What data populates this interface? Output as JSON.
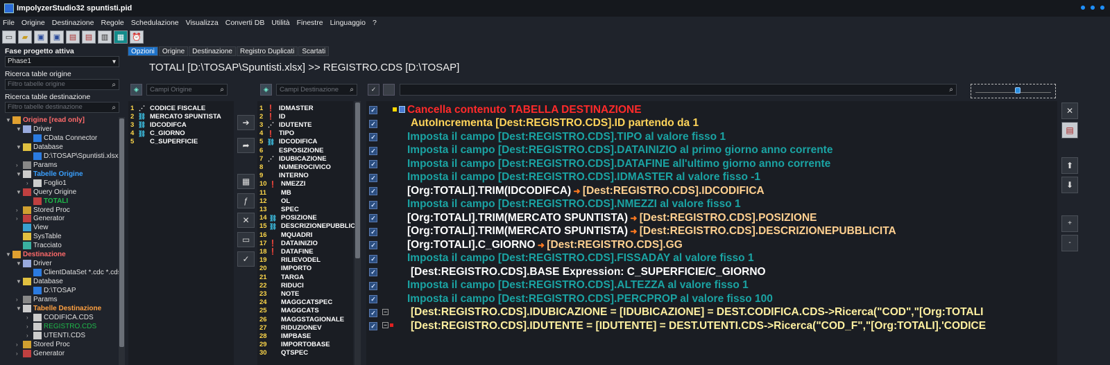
{
  "app": {
    "title": "ImpolyzerStudio32 spuntisti.pid"
  },
  "menu": [
    "File",
    "Origine",
    "Destinazione",
    "Regole",
    "Schedulazione",
    "Visualizza",
    "Converti DB",
    "Utilità",
    "Finestre",
    "Linguaggio",
    "?"
  ],
  "toolbar": {
    "buttons": [
      "new-file-icon",
      "open-folder-icon",
      "save-icon",
      "save-as-icon",
      "print-icon",
      "print-preview-icon",
      "document-icon",
      "execute-icon",
      "schedule-icon"
    ]
  },
  "left": {
    "phase_label": "Fase progetto attiva",
    "phase_value": "Phase1",
    "search_origin_label": "Ricerca table origine",
    "search_origin_placeholder": "Filtro tabelle origine",
    "search_dest_label": "Ricerca table destinazione",
    "search_dest_placeholder": "Filtro tabelle destinazione",
    "tree": [
      {
        "label": "Origine [read only]",
        "level": 0,
        "color": "#ff6a6a",
        "bold": true,
        "exp": "▼",
        "icon": "#e0a030"
      },
      {
        "label": "Driver",
        "level": 1,
        "color": "#e0e0e0",
        "exp": "▼",
        "icon": "#9ad"
      },
      {
        "label": "CData Connector",
        "level": 2,
        "color": "#e0e0e0",
        "exp": "",
        "icon": "#2b7be0"
      },
      {
        "label": "Database",
        "level": 1,
        "color": "#e0e0e0",
        "exp": "▼",
        "icon": "#e0c040"
      },
      {
        "label": "D:\\TOSAP\\Spuntisti.xlsx",
        "level": 2,
        "color": "#e0e0e0",
        "exp": "",
        "icon": "#2b7be0"
      },
      {
        "label": "Params",
        "level": 1,
        "color": "#e0e0e0",
        "exp": "›",
        "icon": "#888"
      },
      {
        "label": "Tabelle Origine",
        "level": 1,
        "color": "#3aa0ff",
        "bold": true,
        "exp": "▼",
        "icon": "#ccc"
      },
      {
        "label": "Foglio1",
        "level": 2,
        "color": "#e0e0e0",
        "exp": "›",
        "icon": "#ccc"
      },
      {
        "label": "Query Origine",
        "level": 1,
        "color": "#e0e0e0",
        "exp": "▼",
        "icon": "#c04040"
      },
      {
        "label": "TOTALI",
        "level": 2,
        "color": "#1fb84a",
        "bold": true,
        "exp": "",
        "icon": "#c04040"
      },
      {
        "label": "Stored Proc",
        "level": 1,
        "color": "#e0e0e0",
        "exp": "›",
        "icon": "#d0a030"
      },
      {
        "label": "Generator",
        "level": 1,
        "color": "#e0e0e0",
        "exp": "›",
        "icon": "#c04040"
      },
      {
        "label": "View",
        "level": 1,
        "color": "#e0e0e0",
        "exp": "",
        "icon": "#3aa0d0"
      },
      {
        "label": "SysTable",
        "level": 1,
        "color": "#e0e0e0",
        "exp": "",
        "icon": "#e0c040"
      },
      {
        "label": "Tracciato",
        "level": 1,
        "color": "#e0e0e0",
        "exp": "",
        "icon": "#3ab0a0"
      },
      {
        "label": "Destinazione",
        "level": 0,
        "color": "#ff6a6a",
        "bold": true,
        "exp": "▼",
        "icon": "#e0a030"
      },
      {
        "label": "Driver",
        "level": 1,
        "color": "#e0e0e0",
        "exp": "▼",
        "icon": "#9ad"
      },
      {
        "label": "ClientDataSet *.cdc *.cds",
        "level": 2,
        "color": "#e0e0e0",
        "exp": "",
        "icon": "#2b7be0"
      },
      {
        "label": "Database",
        "level": 1,
        "color": "#e0e0e0",
        "exp": "▼",
        "icon": "#e0c040"
      },
      {
        "label": "D:\\TOSAP",
        "level": 2,
        "color": "#e0e0e0",
        "exp": "",
        "icon": "#2b7be0"
      },
      {
        "label": "Params",
        "level": 1,
        "color": "#e0e0e0",
        "exp": "›",
        "icon": "#888"
      },
      {
        "label": "Tabelle Destinazione",
        "level": 1,
        "color": "#ffa040",
        "bold": true,
        "exp": "▼",
        "icon": "#ccc"
      },
      {
        "label": "CODIFICA.CDS",
        "level": 2,
        "color": "#e0e0e0",
        "exp": "›",
        "icon": "#ccc"
      },
      {
        "label": "REGISTRO.CDS",
        "level": 2,
        "color": "#1fb84a",
        "exp": "›",
        "icon": "#ccc"
      },
      {
        "label": "UTENTI.CDS",
        "level": 2,
        "color": "#e0e0e0",
        "exp": "›",
        "icon": "#ccc"
      },
      {
        "label": "Stored Proc",
        "level": 1,
        "color": "#e0e0e0",
        "exp": "›",
        "icon": "#d0a030"
      },
      {
        "label": "Generator",
        "level": 1,
        "color": "#e0e0e0",
        "exp": "›",
        "icon": "#c04040"
      }
    ]
  },
  "tabs": [
    {
      "label": "Opzioni",
      "active": true
    },
    {
      "label": "Origine",
      "active": false
    },
    {
      "label": "Destinazione",
      "active": false
    },
    {
      "label": "Registro Duplicati",
      "active": false
    },
    {
      "label": "Scartati",
      "active": false
    }
  ],
  "heading": "TOTALI [D:\\TOSAP\\Spuntisti.xlsx] >> REGISTRO.CDS [D:\\TOSAP]",
  "origin_fields": {
    "placeholder": "Campi Origine",
    "items": [
      {
        "num": "1",
        "name": "CODICE FISCALE",
        "icon": "key"
      },
      {
        "num": "2",
        "name": "MERCATO SPUNTISTA",
        "icon": "link"
      },
      {
        "num": "3",
        "name": "IDCODIFCA",
        "icon": "link"
      },
      {
        "num": "4",
        "name": "C_GIORNO",
        "icon": "link"
      },
      {
        "num": "5",
        "name": "C_SUPERFICIE",
        "icon": ""
      }
    ]
  },
  "dest_fields": {
    "placeholder": "Campi Destinazione",
    "items": [
      {
        "num": "1",
        "name": "IDMASTER",
        "icon": "warn"
      },
      {
        "num": "2",
        "name": "ID",
        "icon": "warn"
      },
      {
        "num": "3",
        "name": "IDUTENTE",
        "icon": "key"
      },
      {
        "num": "4",
        "name": "TIPO",
        "icon": "warn"
      },
      {
        "num": "5",
        "name": "IDCODIFICA",
        "icon": "link"
      },
      {
        "num": "6",
        "name": "ESPOSIZIONE",
        "icon": ""
      },
      {
        "num": "7",
        "name": "IDUBICAZIONE",
        "icon": "key"
      },
      {
        "num": "8",
        "name": "NUMEROCIVICO",
        "icon": ""
      },
      {
        "num": "9",
        "name": "INTERNO",
        "icon": ""
      },
      {
        "num": "10",
        "name": "NMEZZI",
        "icon": "warn"
      },
      {
        "num": "11",
        "name": "MB",
        "icon": ""
      },
      {
        "num": "12",
        "name": "OL",
        "icon": ""
      },
      {
        "num": "13",
        "name": "SPEC",
        "icon": ""
      },
      {
        "num": "14",
        "name": "POSIZIONE",
        "icon": "link"
      },
      {
        "num": "15",
        "name": "DESCRIZIONEPUBBLICI",
        "icon": "link"
      },
      {
        "num": "16",
        "name": "MQUADRI",
        "icon": ""
      },
      {
        "num": "17",
        "name": "DATAINIZIO",
        "icon": "warn"
      },
      {
        "num": "18",
        "name": "DATAFINE",
        "icon": "warn"
      },
      {
        "num": "19",
        "name": "RILIEVODEL",
        "icon": ""
      },
      {
        "num": "20",
        "name": "IMPORTO",
        "icon": ""
      },
      {
        "num": "21",
        "name": "TARGA",
        "icon": ""
      },
      {
        "num": "22",
        "name": "RIDUCI",
        "icon": ""
      },
      {
        "num": "23",
        "name": "NOTE",
        "icon": ""
      },
      {
        "num": "24",
        "name": "MAGGCATSPEC",
        "icon": ""
      },
      {
        "num": "25",
        "name": "MAGGCATS",
        "icon": ""
      },
      {
        "num": "26",
        "name": "MAGGSTAGIONALE",
        "icon": ""
      },
      {
        "num": "27",
        "name": "RIDUZIONEV",
        "icon": ""
      },
      {
        "num": "28",
        "name": "IMPBASE",
        "icon": ""
      },
      {
        "num": "29",
        "name": "IMPORTOBASE",
        "icon": ""
      },
      {
        "num": "30",
        "name": "QTSPEC",
        "icon": ""
      }
    ]
  },
  "rules": [
    {
      "text": "Cancella contenuto TABELLA DESTINAZIONE",
      "color": "#ff2a2a",
      "marker": "yellow",
      "indent": 0
    },
    {
      "text": "AutoIncrementa [Dest:REGISTRO.CDS].ID partendo da 1",
      "color": "#ffd45a",
      "marker": "",
      "indent": 5
    },
    {
      "text": "Imposta il campo  [Dest:REGISTRO.CDS].TIPO al valore fisso 1",
      "color": "#1aa3a3",
      "marker": "",
      "indent": 0
    },
    {
      "text": "Imposta il campo  [Dest:REGISTRO.CDS].DATAINIZIO al primo giorno anno corrente",
      "color": "#1aa3a3",
      "marker": "",
      "indent": 0
    },
    {
      "text": "Imposta il campo  [Dest:REGISTRO.CDS].DATAFINE all'ultimo giorno anno corrente",
      "color": "#1aa3a3",
      "marker": "",
      "indent": 0
    },
    {
      "text": "Imposta il campo  [Dest:REGISTRO.CDS].IDMASTER al valore fisso -1",
      "color": "#1aa3a3",
      "marker": "",
      "indent": 0
    },
    {
      "parts": [
        "[Org:TOTALI].TRIM(IDCODIFCA)",
        "[Dest:REGISTRO.CDS].IDCODIFICA"
      ],
      "color": "#ffffff",
      "color2": "#ffd090",
      "marker": "",
      "indent": 0
    },
    {
      "text": "Imposta il campo  [Dest:REGISTRO.CDS].NMEZZI al valore fisso 1",
      "color": "#1aa3a3",
      "marker": "",
      "indent": 0
    },
    {
      "parts": [
        "[Org:TOTALI].TRIM(MERCATO SPUNTISTA)",
        "[Dest:REGISTRO.CDS].POSIZIONE"
      ],
      "color": "#ffffff",
      "color2": "#ffd090",
      "marker": "",
      "indent": 0
    },
    {
      "parts": [
        "[Org:TOTALI].TRIM(MERCATO SPUNTISTA)",
        "[Dest:REGISTRO.CDS].DESCRIZIONEPUBBLICITA"
      ],
      "color": "#ffffff",
      "color2": "#ffd090",
      "marker": "",
      "indent": 0
    },
    {
      "parts": [
        "[Org:TOTALI].C_GIORNO",
        "[Dest:REGISTRO.CDS].GG"
      ],
      "color": "#ffffff",
      "color2": "#ffd090",
      "marker": "",
      "indent": 0
    },
    {
      "text": "Imposta il campo  [Dest:REGISTRO.CDS].FISSADAY al valore fisso 1",
      "color": "#1aa3a3",
      "marker": "",
      "indent": 0
    },
    {
      "text": "[Dest:REGISTRO.CDS].BASE Expression: C_SUPERFICIE/C_GIORNO",
      "color": "#ffffff",
      "marker": "",
      "indent": 5
    },
    {
      "text": "Imposta il campo  [Dest:REGISTRO.CDS].ALTEZZA al valore fisso 1",
      "color": "#1aa3a3",
      "marker": "",
      "indent": 0
    },
    {
      "text": "Imposta il campo  [Dest:REGISTRO.CDS].PERCPROP al valore fisso 100",
      "color": "#1aa3a3",
      "marker": "",
      "indent": 0
    },
    {
      "text": "[Dest:REGISTRO.CDS].IDUBICAZIONE = [IDUBICAZIONE] = DEST.CODIFICA.CDS->Ricerca(\"COD\",\"[Org:TOTALI",
      "color": "#fff0a0",
      "marker": "minus",
      "indent": 5
    },
    {
      "text": "[Dest:REGISTRO.CDS].IDUTENTE = [IDUTENTE] = DEST.UTENTI.CDS->Ricerca(\"COD_F\",\"[Org:TOTALI].'CODICE",
      "color": "#fff0a0",
      "marker": "minusred",
      "indent": 5
    }
  ],
  "colors": {
    "accent": "#1e72c8",
    "background": "#1f232b",
    "panel": "#1a1d23"
  }
}
